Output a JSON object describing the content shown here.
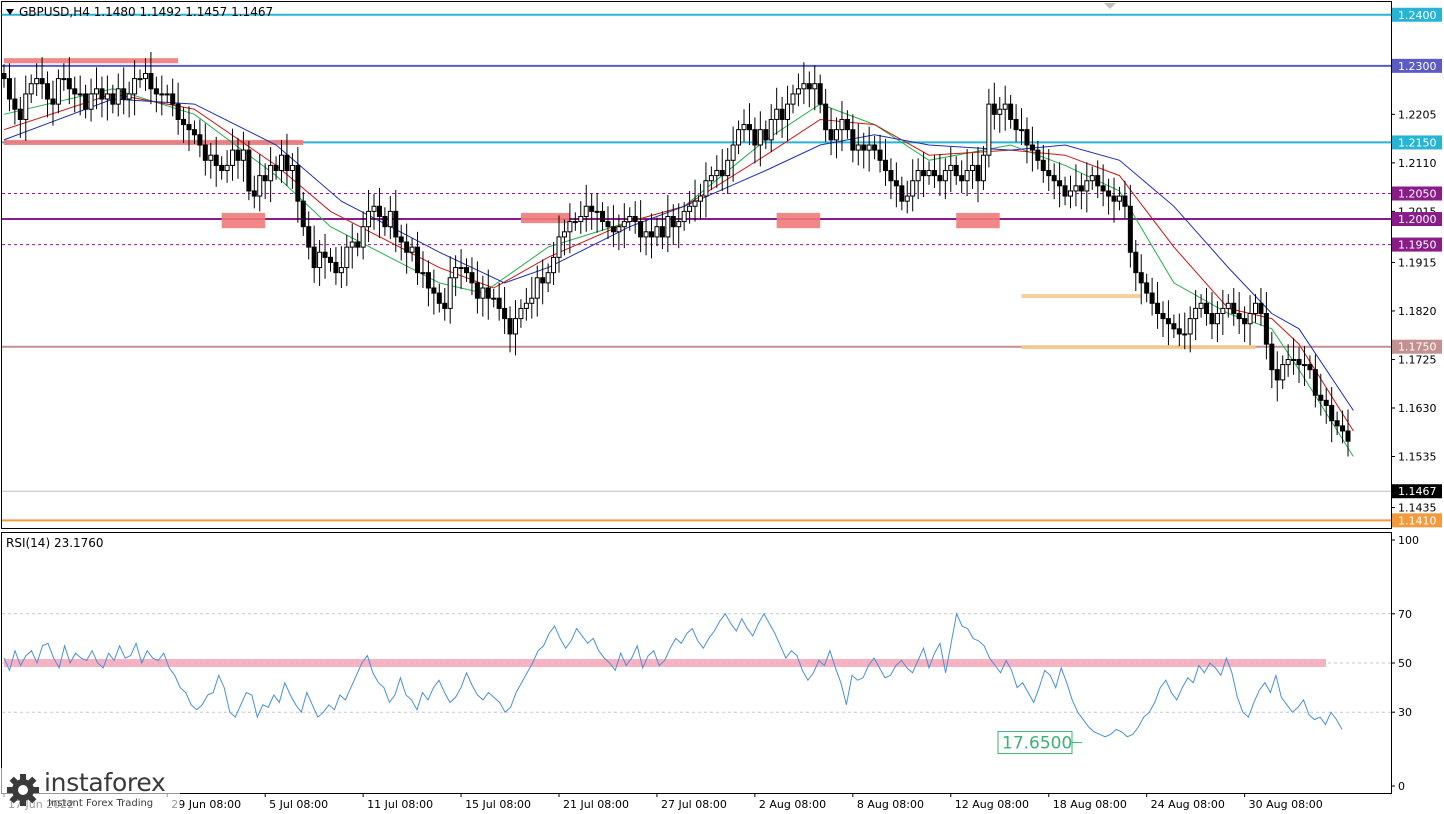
{
  "colors": {
    "background": "#ffffff",
    "frame": "#000000",
    "grid_dash": "#c8c8c8",
    "candle_up": "#ffffff",
    "candle_down": "#000000",
    "candle_border": "#000000",
    "ma_fast": "#23b14d",
    "ma_mid": "#d11515",
    "ma_slow": "#1f2fb3",
    "rsi_line": "#4a90d9",
    "rsi_mid_band": "#f4a6b8",
    "level_cyan": "#26b5d4",
    "level_blue": "#5b5bc8",
    "level_purple": "#8a1c8a",
    "level_rose": "#c49090",
    "level_orange": "#f39a3c",
    "current_price_bg": "#000000",
    "zone_red": "#f07a7a",
    "zone_yellow": "#f5c98f"
  },
  "icons": {
    "menu": "triangle-down-icon",
    "scroll": "triangle-down-icon",
    "logo": "gear-icon"
  },
  "chart_data": [
    {
      "type": "candlestick",
      "title": "GBPUSD,H4  1.1480 1.1492 1.1457 1.1467",
      "symbol": "GBPUSD",
      "timeframe": "H4",
      "ohlc_current": {
        "open": 1.148,
        "high": 1.1492,
        "low": 1.1457,
        "close": 1.1467
      },
      "ylim": [
        1.1395,
        1.2425
      ],
      "grid": false,
      "y_ticks": [
        1.1435,
        1.1535,
        1.163,
        1.1725,
        1.182,
        1.1915,
        1.2015,
        1.211,
        1.2205
      ],
      "y_tick_labels": [
        "1.1435",
        "1.1535",
        "1.1630",
        "1.1725",
        "1.1820",
        "1.1915",
        "1.2015",
        "1.2110",
        "1.2205"
      ],
      "price_levels": [
        {
          "value": 1.24,
          "label": "1.2400",
          "color": "#26b5d4",
          "style": "solid"
        },
        {
          "value": 1.23,
          "label": "1.2300",
          "color": "#5b5bc8",
          "style": "solid"
        },
        {
          "value": 1.215,
          "label": "1.2150",
          "color": "#26b5d4",
          "style": "solid"
        },
        {
          "value": 1.205,
          "label": "1.2050",
          "color": "#8a1c8a",
          "style": "dashed"
        },
        {
          "value": 1.2,
          "label": "1.2000",
          "color": "#8a1c8a",
          "style": "solid"
        },
        {
          "value": 1.195,
          "label": "1.1950",
          "color": "#8a1c8a",
          "style": "dashed"
        },
        {
          "value": 1.175,
          "label": "1.1750",
          "color": "#c49090",
          "style": "solid"
        },
        {
          "value": 1.141,
          "label": "1.1410",
          "color": "#f39a3c",
          "style": "solid"
        }
      ],
      "current_price": {
        "value": 1.1467,
        "label": "1.1467"
      },
      "x_labels": [
        "17 Jun 2022",
        "29 Jun 08:00",
        "5 Jul 08:00",
        "11 Jul 08:00",
        "15 Jul 08:00",
        "21 Jul 08:00",
        "27 Jul 08:00",
        "2 Aug 08:00",
        "8 Aug 08:00",
        "12 Aug 08:00",
        "18 Aug 08:00",
        "24 Aug 08:00",
        "30 Aug 08:00"
      ],
      "x_label_positions": [
        0,
        30,
        48,
        66,
        84,
        102,
        120,
        138,
        156,
        174,
        192,
        210,
        228
      ],
      "n_bars": 248,
      "close": [
        1.2275,
        1.2235,
        1.2215,
        1.2195,
        1.2245,
        1.2265,
        1.2275,
        1.2265,
        1.2235,
        1.2225,
        1.2275,
        1.2275,
        1.2255,
        1.2245,
        1.2245,
        1.2215,
        1.2245,
        1.2255,
        1.2235,
        1.2245,
        1.2225,
        1.2255,
        1.2235,
        1.2245,
        1.2275,
        1.2275,
        1.2285,
        1.2255,
        1.2245,
        1.2245,
        1.2245,
        1.2225,
        1.2195,
        1.2185,
        1.2175,
        1.2165,
        1.2145,
        1.2115,
        1.2125,
        1.2105,
        1.2095,
        1.2105,
        1.2135,
        1.2115,
        1.2135,
        1.2055,
        1.2045,
        1.2085,
        1.2075,
        1.2105,
        1.2095,
        1.2125,
        1.2095,
        1.2105,
        1.2035,
        1.1985,
        1.1945,
        1.1905,
        1.1935,
        1.1925,
        1.1915,
        1.1895,
        1.1905,
        1.1945,
        1.1955,
        1.1945,
        1.1985,
        1.2015,
        1.2025,
        1.2005,
        1.1985,
        1.2015,
        1.1965,
        1.1955,
        1.1935,
        1.1945,
        1.1895,
        1.1895,
        1.1865,
        1.1855,
        1.1835,
        1.1825,
        1.1885,
        1.1905,
        1.1905,
        1.1895,
        1.1875,
        1.1845,
        1.1865,
        1.1845,
        1.1845,
        1.1825,
        1.1805,
        1.1775,
        1.1805,
        1.1825,
        1.1835,
        1.1845,
        1.1885,
        1.1875,
        1.1895,
        1.1925,
        1.1965,
        1.1975,
        1.1995,
        1.1995,
        1.2005,
        1.2025,
        1.2015,
        1.2015,
        1.1995,
        1.1985,
        1.1975,
        1.1985,
        1.1995,
        1.2005,
        1.1995,
        1.1965,
        1.1975,
        1.1965,
        1.1985,
        1.1965,
        1.2005,
        1.1985,
        1.1995,
        1.2015,
        1.2025,
        1.2035,
        1.2045,
        1.2075,
        1.2085,
        1.2095,
        1.2085,
        1.2115,
        1.2145,
        1.2175,
        1.2185,
        1.2175,
        1.2145,
        1.2175,
        1.2155,
        1.2195,
        1.2215,
        1.2195,
        1.2225,
        1.2245,
        1.2255,
        1.2265,
        1.2255,
        1.2265,
        1.2225,
        1.2175,
        1.2155,
        1.2175,
        1.2195,
        1.2175,
        1.2135,
        1.2145,
        1.2135,
        1.2145,
        1.2135,
        1.2115,
        1.2095,
        1.2075,
        1.2065,
        1.2035,
        1.2045,
        1.2075,
        1.2095,
        1.2085,
        1.2095,
        1.2085,
        1.2075,
        1.2095,
        1.2105,
        1.2085,
        1.2075,
        1.2095,
        1.2105,
        1.2075,
        1.2125,
        1.2225,
        1.2205,
        1.2215,
        1.2225,
        1.2195,
        1.2175,
        1.2175,
        1.2145,
        1.2135,
        1.2115,
        1.2095,
        1.2085,
        1.2075,
        1.2065,
        1.2045,
        1.2055,
        1.2065,
        1.2055,
        1.2075,
        1.2085,
        1.2065,
        1.2055,
        1.2045,
        1.2035,
        1.2045,
        1.2025,
        1.1935,
        1.1895,
        1.1875,
        1.1855,
        1.1835,
        1.1815,
        1.1805,
        1.1795,
        1.1785,
        1.1775,
        1.1775,
        1.1805,
        1.1825,
        1.1835,
        1.1815,
        1.1795,
        1.1815,
        1.1825,
        1.1835,
        1.1815,
        1.1805,
        1.1795,
        1.1815,
        1.1835,
        1.1815,
        1.1755,
        1.1705,
        1.1685,
        1.1715,
        1.1725,
        1.1725,
        1.1715,
        1.1715,
        1.1705,
        1.1655,
        1.1645,
        1.1635,
        1.1605,
        1.1595,
        1.1585,
        1.1565,
        1.1555,
        1.1545,
        1.1535,
        1.1525,
        1.1505,
        1.1485,
        1.1467
      ],
      "moving_averages": [
        {
          "period": "fast",
          "color": "#23b14d",
          "points": [
            [
              0,
              1.2205
            ],
            [
              20,
              1.2255
            ],
            [
              35,
              1.2205
            ],
            [
              50,
              1.2085
            ],
            [
              60,
              1.1985
            ],
            [
              80,
              1.1875
            ],
            [
              88,
              1.1855
            ],
            [
              100,
              1.1945
            ],
            [
              115,
              1.1995
            ],
            [
              125,
              1.2025
            ],
            [
              140,
              1.2155
            ],
            [
              150,
              1.2225
            ],
            [
              160,
              1.2185
            ],
            [
              170,
              1.2115
            ],
            [
              185,
              1.2145
            ],
            [
              195,
              1.2105
            ],
            [
              205,
              1.2055
            ],
            [
              215,
              1.1875
            ],
            [
              225,
              1.1815
            ],
            [
              233,
              1.1785
            ],
            [
              238,
              1.1705
            ],
            [
              248,
              1.1535
            ]
          ]
        },
        {
          "period": "mid",
          "color": "#d11515",
          "points": [
            [
              0,
              1.2175
            ],
            [
              20,
              1.2245
            ],
            [
              35,
              1.2215
            ],
            [
              50,
              1.2105
            ],
            [
              60,
              1.2015
            ],
            [
              80,
              1.1905
            ],
            [
              90,
              1.1865
            ],
            [
              100,
              1.1925
            ],
            [
              115,
              1.1995
            ],
            [
              125,
              1.2025
            ],
            [
              140,
              1.2125
            ],
            [
              150,
              1.2195
            ],
            [
              160,
              1.2185
            ],
            [
              170,
              1.2125
            ],
            [
              185,
              1.2135
            ],
            [
              195,
              1.2125
            ],
            [
              205,
              1.2085
            ],
            [
              215,
              1.1945
            ],
            [
              225,
              1.1825
            ],
            [
              233,
              1.1805
            ],
            [
              238,
              1.1755
            ],
            [
              248,
              1.1585
            ]
          ]
        },
        {
          "period": "slow",
          "color": "#1f2fb3",
          "points": [
            [
              0,
              1.2155
            ],
            [
              20,
              1.2235
            ],
            [
              35,
              1.2225
            ],
            [
              50,
              1.2145
            ],
            [
              62,
              1.2035
            ],
            [
              80,
              1.1935
            ],
            [
              92,
              1.1875
            ],
            [
              100,
              1.1905
            ],
            [
              115,
              1.1985
            ],
            [
              125,
              1.2025
            ],
            [
              140,
              1.2095
            ],
            [
              150,
              1.2145
            ],
            [
              160,
              1.2165
            ],
            [
              170,
              1.2145
            ],
            [
              185,
              1.2135
            ],
            [
              195,
              1.2145
            ],
            [
              205,
              1.2115
            ],
            [
              215,
              1.2025
            ],
            [
              225,
              1.1905
            ],
            [
              233,
              1.1815
            ],
            [
              238,
              1.1785
            ],
            [
              248,
              1.1625
            ]
          ]
        }
      ],
      "zones": [
        {
          "x0": 0,
          "x1": 32,
          "y0": 1.2315,
          "y1": 1.2305,
          "color": "#f07a7a"
        },
        {
          "x0": 0,
          "x1": 55,
          "y0": 1.2155,
          "y1": 1.2145,
          "color": "#f07a7a"
        },
        {
          "x0": 40,
          "x1": 48,
          "y0": 1.2012,
          "y1": 1.1982,
          "color": "#f07a7a"
        },
        {
          "x0": 95,
          "x1": 104,
          "y0": 1.2012,
          "y1": 1.1992,
          "color": "#f07a7a"
        },
        {
          "x0": 142,
          "x1": 150,
          "y0": 1.2012,
          "y1": 1.1982,
          "color": "#f07a7a"
        },
        {
          "x0": 175,
          "x1": 183,
          "y0": 1.2012,
          "y1": 1.1982,
          "color": "#f07a7a"
        },
        {
          "x0": 187,
          "x1": 209,
          "y0": 1.1853,
          "y1": 1.1847,
          "color": "#f5c98f"
        },
        {
          "x0": 187,
          "x1": 230,
          "y0": 1.1753,
          "y1": 1.1747,
          "color": "#f5c98f"
        }
      ]
    },
    {
      "type": "line",
      "title": "RSI(14) 23.1760",
      "series": [
        {
          "name": "RSI(14)",
          "color": "#4a90d9",
          "values": [
            52,
            47,
            55,
            49,
            53,
            55,
            50,
            57,
            58,
            52,
            48,
            57,
            50,
            54,
            52,
            51,
            55,
            50,
            48,
            54,
            51,
            57,
            52,
            53,
            58,
            50,
            55,
            52,
            51,
            54,
            48,
            45,
            40,
            38,
            33,
            31,
            33,
            37,
            38,
            45,
            40,
            30,
            28,
            33,
            38,
            37,
            28,
            33,
            32,
            37,
            34,
            42,
            37,
            33,
            30,
            38,
            33,
            28,
            30,
            33,
            31,
            37,
            35,
            40,
            45,
            50,
            53,
            46,
            42,
            40,
            34,
            37,
            44,
            37,
            35,
            31,
            38,
            35,
            40,
            43,
            38,
            34,
            36,
            40,
            46,
            41,
            37,
            35,
            38,
            36,
            34,
            30,
            32,
            38,
            42,
            46,
            50,
            55,
            57,
            62,
            65,
            60,
            56,
            59,
            64,
            61,
            58,
            60,
            55,
            52,
            50,
            47,
            54,
            49,
            52,
            57,
            48,
            53,
            55,
            49,
            51,
            56,
            60,
            58,
            62,
            64,
            59,
            56,
            60,
            63,
            67,
            70,
            66,
            63,
            68,
            64,
            61,
            66,
            70,
            66,
            62,
            57,
            52,
            55,
            53,
            47,
            43,
            46,
            51,
            49,
            55,
            48,
            42,
            33,
            45,
            43,
            44,
            49,
            52,
            48,
            44,
            45,
            49,
            51,
            48,
            46,
            51,
            56,
            48,
            54,
            58,
            46,
            58,
            70,
            65,
            64,
            60,
            59,
            57,
            52,
            49,
            46,
            51,
            47,
            40,
            42,
            38,
            34,
            40,
            47,
            45,
            40,
            48,
            42,
            35,
            30,
            27,
            24,
            22,
            21,
            20,
            21,
            23,
            22,
            20,
            21,
            24,
            28,
            30,
            34,
            40,
            43,
            38,
            35,
            40,
            44,
            42,
            49,
            46,
            50,
            48,
            45,
            52,
            46,
            36,
            30,
            28,
            34,
            39,
            42,
            38,
            45,
            36,
            33,
            30,
            32,
            35,
            29,
            27,
            28,
            25,
            30,
            27,
            23
          ],
          "label": "RSI(14) 23.1760"
        }
      ],
      "ylim": [
        0,
        100
      ],
      "y_ticks": [
        0,
        30,
        50,
        70,
        100
      ],
      "y_tick_labels": [
        "0",
        "30",
        "50",
        "70",
        "100"
      ],
      "levels": [
        70,
        50,
        30
      ],
      "annotation": {
        "text": "17.6500",
        "value": 17.65
      }
    }
  ],
  "watermark": {
    "brand": "instaforex",
    "tagline": "Instant Forex Trading"
  }
}
